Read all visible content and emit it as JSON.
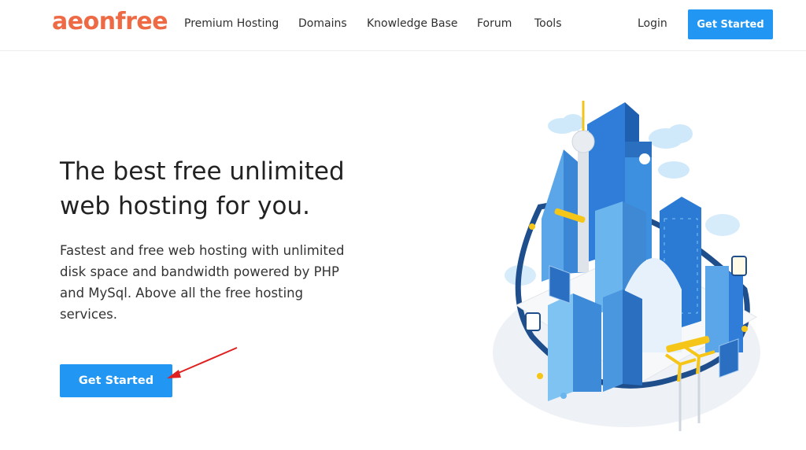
{
  "header": {
    "logo": "aeonfree",
    "nav": [
      "Premium Hosting",
      "Domains",
      "Knowledge Base",
      "Forum",
      "Tools"
    ],
    "login_label": "Login",
    "cta_label": "Get Started"
  },
  "hero": {
    "title": "The best free unlimited web hosting for you.",
    "description": "Fastest and free web hosting with unlimited disk space and bandwidth powered by PHP and MySql. Above all the free hosting services.",
    "cta_label": "Get Started"
  },
  "colors": {
    "brand": "#ee6a45",
    "accent": "#2196f3",
    "annotation_arrow": "#e02020"
  },
  "icons": [
    "red-annotation-arrow",
    "city-illustration"
  ]
}
